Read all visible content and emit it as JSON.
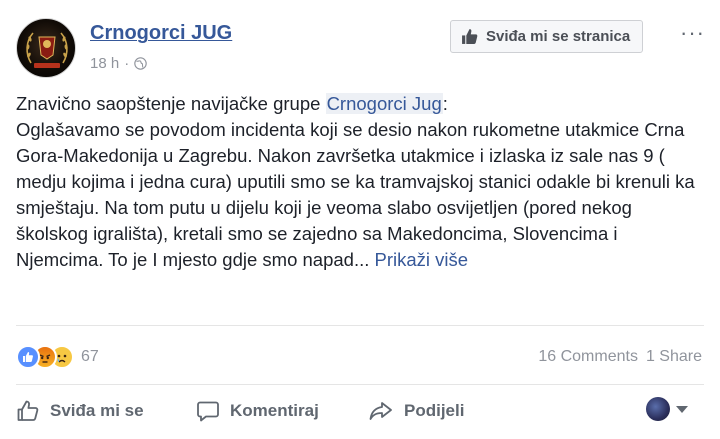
{
  "post": {
    "author": "Crnogorci JUG",
    "time": "18 h",
    "separator": "·",
    "like_page_label": "Sviđa mi se stranica",
    "more_label": "···",
    "avatar_text": "Crnogorci Jug",
    "text": {
      "line_intro_before": "Znavično saopštenje navijačke grupe ",
      "mention": "Crnogorci Jug",
      "line_intro_after": ":",
      "body": "Oglašavamo se povodom incidenta koji se desio nakon rukometne utakmice Crna Gora-Makedonija u Zagrebu. Nakon završetka utakmice i izlaska iz sale nas 9 ( medju kojima i jedna cura) uputili smo se ka tramvajskoj stanici odakle bi krenuli ka smještaju. Na tom putu u dijelu koji je veoma slabo osvijetljen (pored nekog školskog igrališta), kretali smo se zajedno sa Makedoncima, Slovencima i Njemcima. To je I mjesto gdje smo napad...",
      "see_more": "Prikaži više"
    }
  },
  "engagement": {
    "reaction_count": "67",
    "comments": "16 Comments",
    "shares": "1 Share",
    "reaction_icons": [
      "like-icon",
      "angry-icon",
      "sad-icon"
    ]
  },
  "actions": {
    "like": "Sviđa mi se",
    "comment": "Komentiraj",
    "share": "Podijeli"
  },
  "colors": {
    "link": "#365899",
    "muted": "#90949c",
    "action": "#606770",
    "like_reaction": "#5890ff"
  }
}
